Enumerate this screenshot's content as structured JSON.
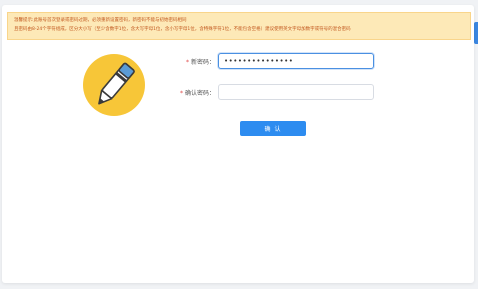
{
  "notice": {
    "line1": "温馨提示:此账号首次登录或密码过期，必须重新设置密码，新密码不能与初始密码相同",
    "line2": "且密码由8-24个字符组成，区分大小写（至少含数字1位，含大写字母1位，含小写字母1位，含特殊字符1位，不能包含空格）建议使用英文字母加数字或符号的混合密码"
  },
  "form": {
    "new_password_label": "新密码：",
    "new_password_value": "•••••••••••••••",
    "confirm_password_label": "确认密码：",
    "confirm_password_value": "",
    "required_mark": "*",
    "submit_label": "确 认"
  },
  "icons": {
    "illustration": "pen-illustration-icon"
  },
  "colors": {
    "notice_bg": "#fde9b7",
    "notice_text": "#c2581f",
    "primary": "#2d8cf0",
    "required": "#e04848",
    "illustration_circle": "#f7c638"
  }
}
